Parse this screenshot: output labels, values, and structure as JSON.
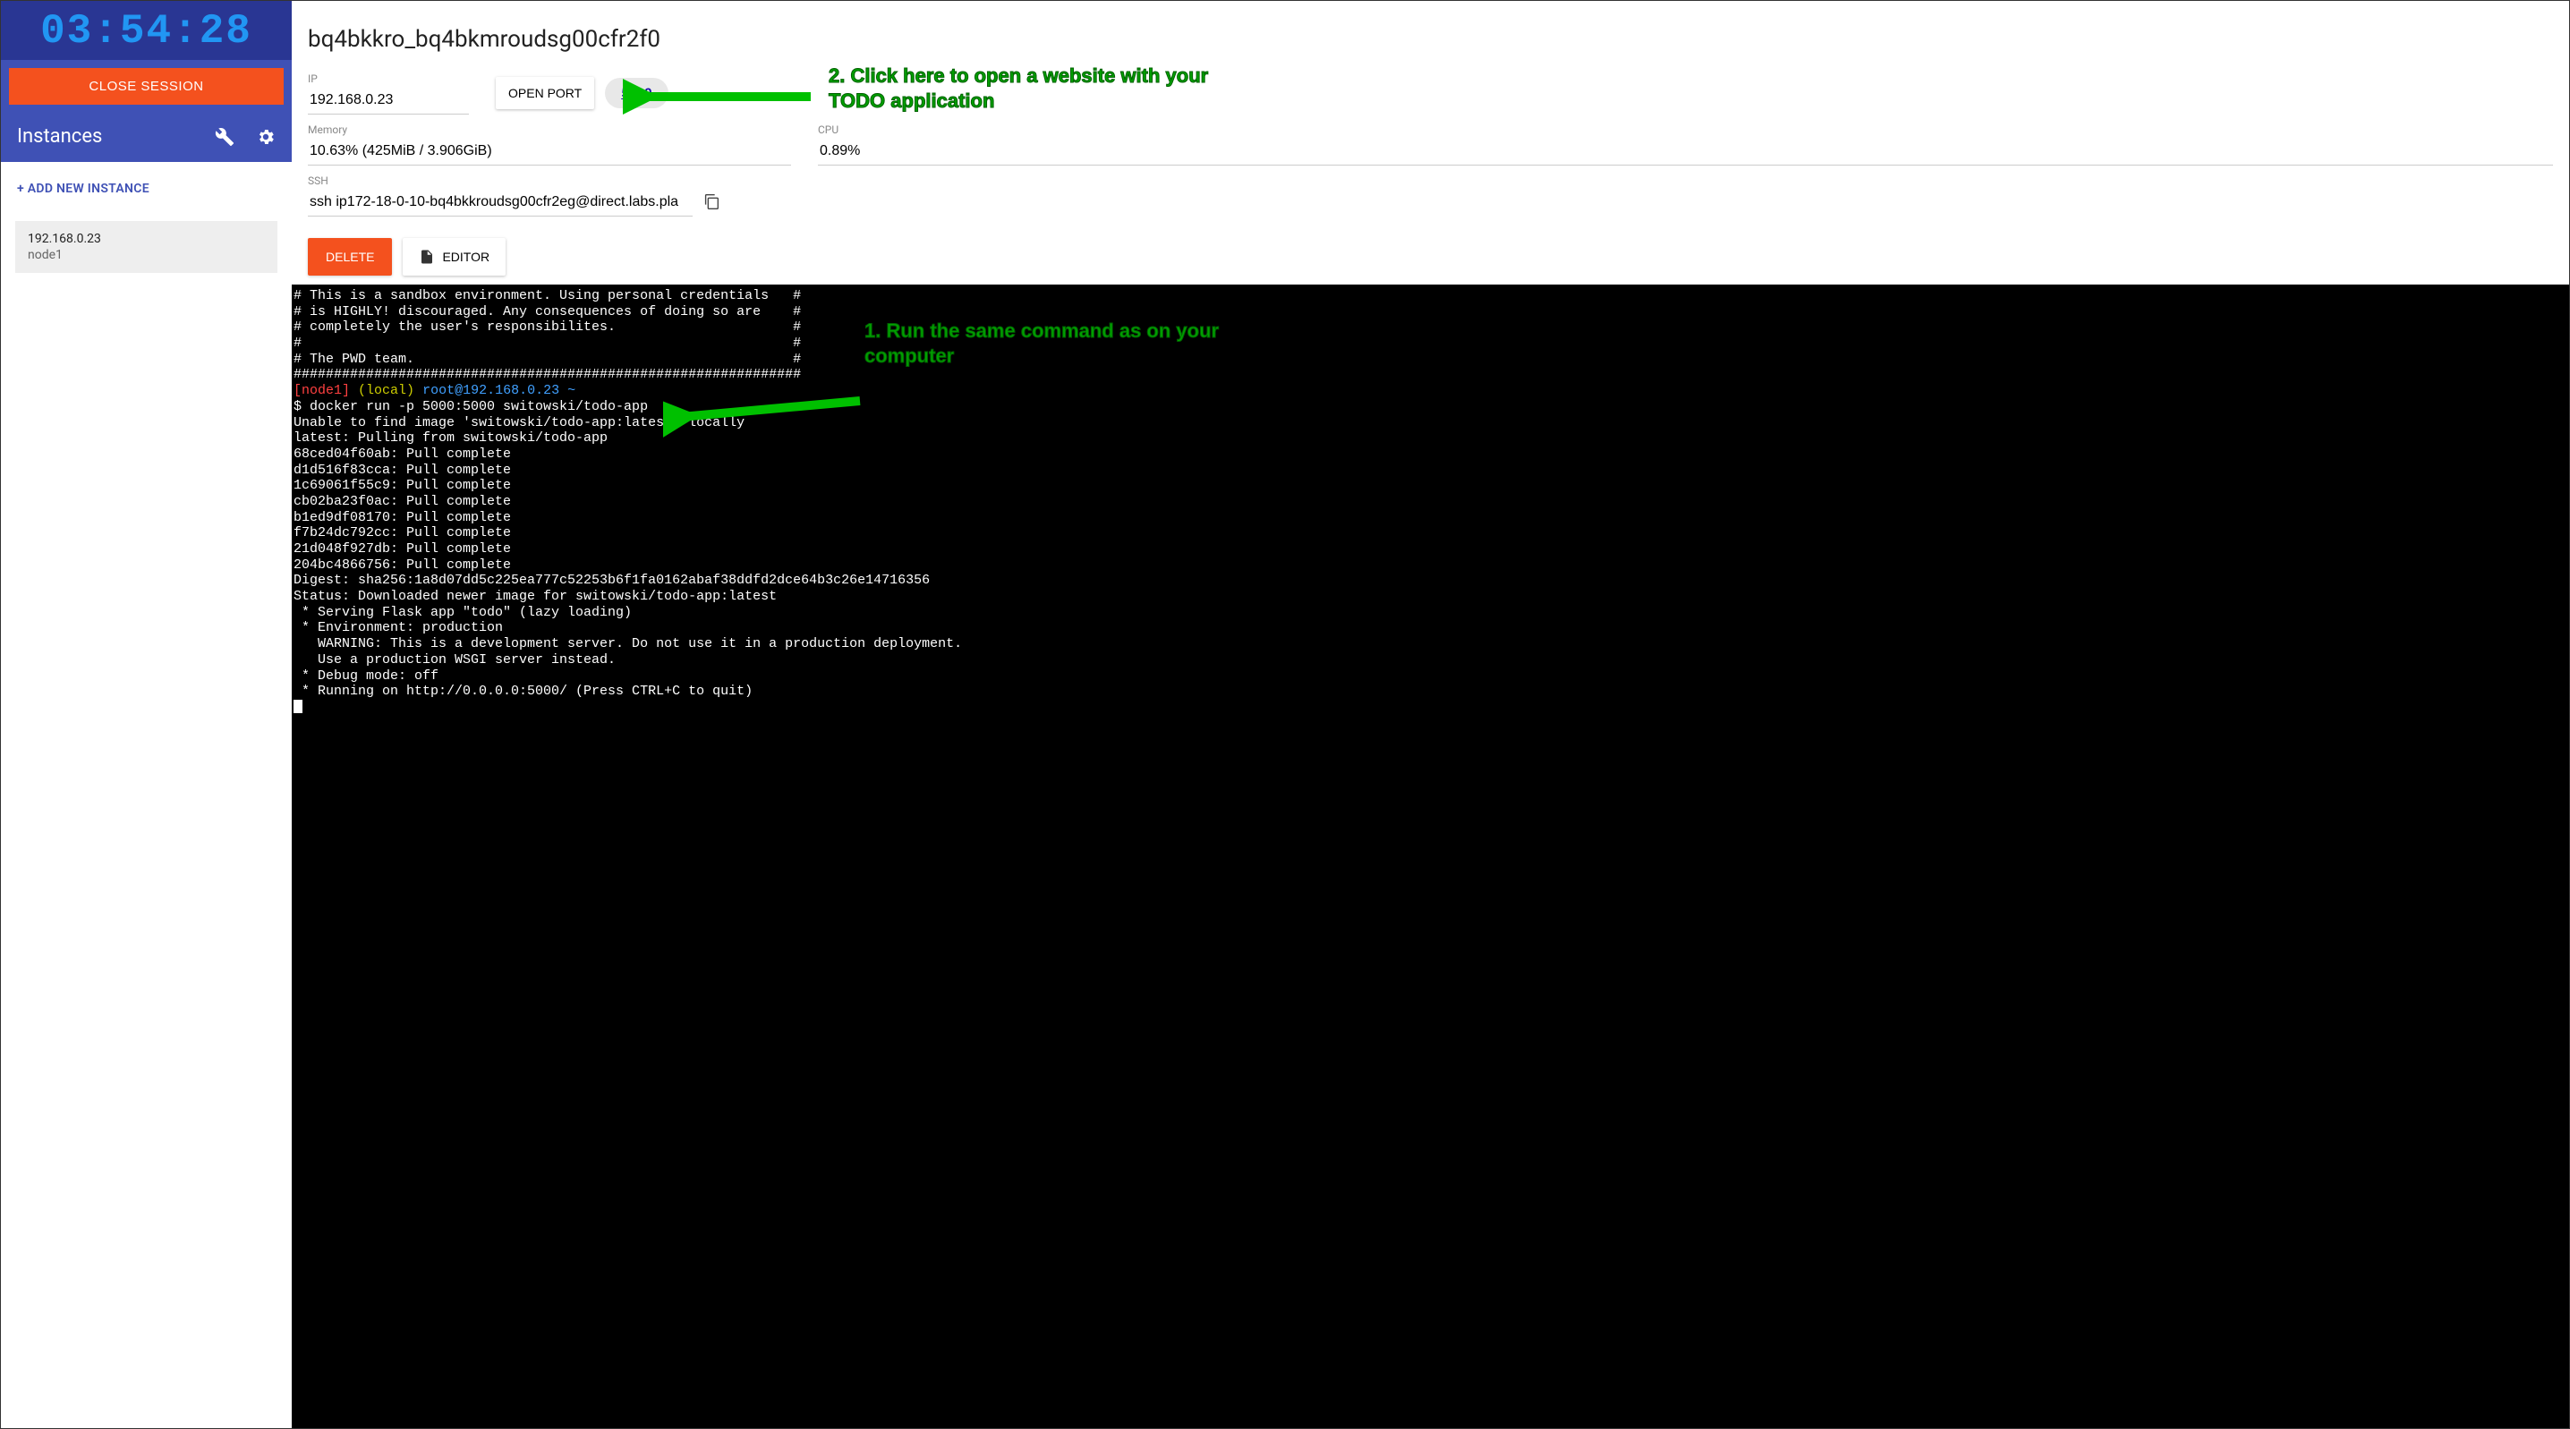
{
  "sidebar": {
    "timer": "03:54:28",
    "close_label": "CLOSE SESSION",
    "instances_label": "Instances",
    "add_label": "+ ADD NEW INSTANCE",
    "instance": {
      "ip": "192.168.0.23",
      "name": "node1"
    }
  },
  "details": {
    "title": "bq4bkkro_bq4bkmroudsg00cfr2f0",
    "ip_label": "IP",
    "ip_value": "192.168.0.23",
    "open_port_label": "OPEN PORT",
    "port_chip": "5000",
    "memory_label": "Memory",
    "memory_value": "10.63% (425MiB / 3.906GiB)",
    "cpu_label": "CPU",
    "cpu_value": "0.89%",
    "ssh_label": "SSH",
    "ssh_value": "ssh ip172-18-0-10-bq4bkkroudsg00cfr2eg@direct.labs.pla",
    "delete_label": "DELETE",
    "editor_label": "EDITOR"
  },
  "annotations": {
    "callout2": "2. Click here to open a website with your TODO application",
    "callout1": "1. Run the same command as on your computer"
  },
  "terminal": {
    "box_lines": [
      "# This is a sandbox environment. Using personal credentials   #",
      "# is HIGHLY! discouraged. Any consequences of doing so are    #",
      "# completely the user's responsibilites.                      #",
      "#                                                             #",
      "# The PWD team.                                               #",
      "###############################################################"
    ],
    "prompt_node": "[node1]",
    "prompt_local": "(local)",
    "prompt_userhost": "root@192.168.0.23 ~",
    "cmd_prefix": "$ ",
    "cmd": "docker run -p 5000:5000 switowski/todo-app",
    "output": [
      "Unable to find image 'switowski/todo-app:latest' locally",
      "latest: Pulling from switowski/todo-app",
      "68ced04f60ab: Pull complete",
      "d1d516f83cca: Pull complete",
      "1c69061f55c9: Pull complete",
      "cb02ba23f0ac: Pull complete",
      "b1ed9df08170: Pull complete",
      "f7b24dc792cc: Pull complete",
      "21d048f927db: Pull complete",
      "204bc4866756: Pull complete",
      "Digest: sha256:1a8d07dd5c225ea777c52253b6f1fa0162abaf38ddfd2dce64b3c26e14716356",
      "Status: Downloaded newer image for switowski/todo-app:latest",
      " * Serving Flask app \"todo\" (lazy loading)",
      " * Environment: production",
      "   WARNING: This is a development server. Do not use it in a production deployment.",
      "   Use a production WSGI server instead.",
      " * Debug mode: off",
      " * Running on http://0.0.0.0:5000/ (Press CTRL+C to quit)"
    ]
  }
}
